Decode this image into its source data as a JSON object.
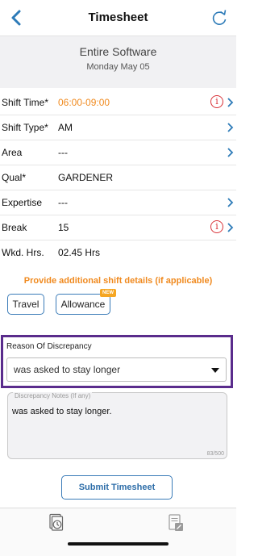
{
  "nav": {
    "title": "Timesheet",
    "back_icon": "chevron-left-icon",
    "refresh_icon": "refresh-icon",
    "accent": "#2d7bb8"
  },
  "header": {
    "company": "Entire Software",
    "date": "Monday May 05"
  },
  "rows": [
    {
      "label": "Shift Time*",
      "value": "06:00-09:00",
      "value_color": "#f08a1f",
      "info": true,
      "chevron": true
    },
    {
      "label": "Shift Type*",
      "value": "AM",
      "info": false,
      "chevron": true
    },
    {
      "label": "Area",
      "value": "---",
      "info": false,
      "chevron": true
    },
    {
      "label": "Qual*",
      "value": "GARDENER",
      "info": false,
      "chevron": false
    },
    {
      "label": "Expertise",
      "value": "---",
      "info": false,
      "chevron": true
    },
    {
      "label": "Break",
      "value": "15",
      "info": true,
      "chevron": true
    },
    {
      "label": "Wkd. Hrs.",
      "value": "02.45 Hrs",
      "info": false,
      "chevron": false
    }
  ],
  "info_icon_glyph": "i",
  "additional": {
    "notice": "Provide additional shift details (if applicable)",
    "travel_label": "Travel",
    "allowance_label": "Allowance",
    "new_badge": "NEW"
  },
  "discrepancy": {
    "label": "Reason Of Discrepancy",
    "selected": "was asked to stay longer",
    "highlight_color": "#5a2c8c"
  },
  "notes": {
    "placeholder": "Discrepancy Notes (If any)",
    "value": "was asked to stay longer.",
    "counter": "83/500"
  },
  "submit_label": "Submit Timesheet",
  "tabbar": {
    "tabs": [
      "timesheet-clock-icon",
      "document-pen-icon"
    ]
  }
}
